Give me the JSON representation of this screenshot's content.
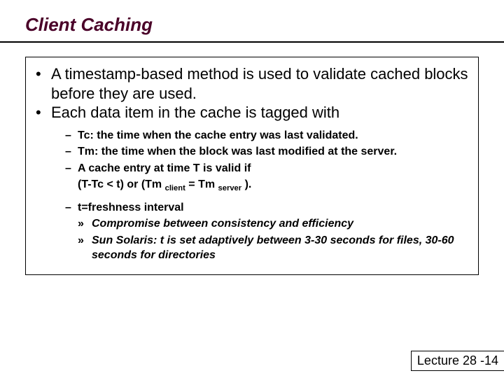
{
  "title": "Client Caching",
  "bullets": {
    "b1": "A timestamp-based method is used to validate cached blocks before they are used.",
    "b2": "Each data item in the cache is tagged with"
  },
  "dashes": {
    "d1": "Tc: the time when the cache entry was last validated.",
    "d2": "Tm: the time when the block was last modified at the server.",
    "d3": "A cache entry at time T is valid if",
    "d4": "t=freshness interval"
  },
  "formula": {
    "p1": "(T-Tc < t) or (Tm",
    "sub1": "client",
    "p2": " = Tm",
    "sub2": "server",
    "p3": ")."
  },
  "subs": {
    "s1": "Compromise between consistency and efficiency",
    "s2": "Sun Solaris: t is set adaptively between 3-30 seconds for files, 30-60 seconds for directories"
  },
  "footer": "Lecture 28 -14"
}
